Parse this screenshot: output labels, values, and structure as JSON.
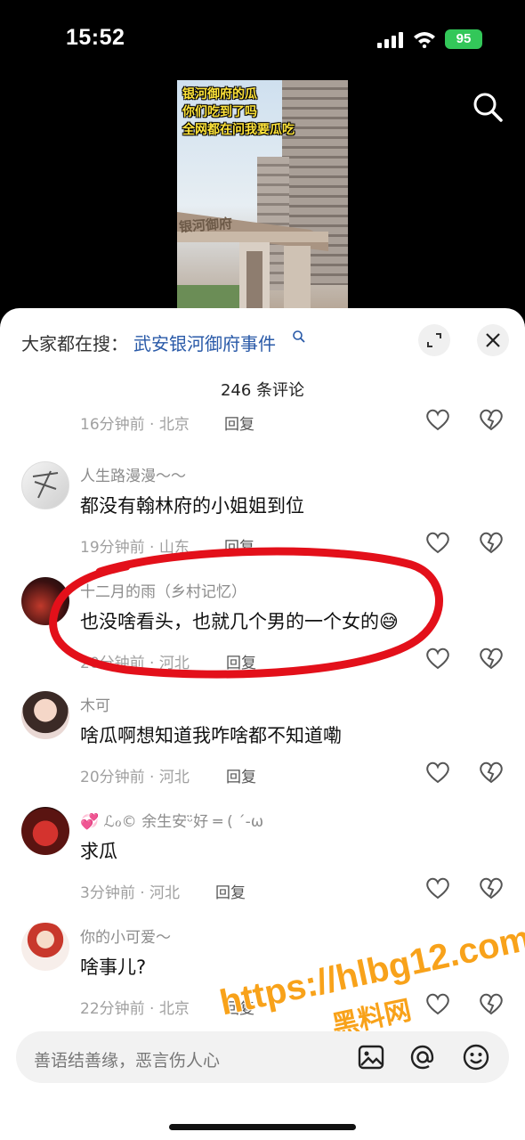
{
  "status_bar": {
    "time": "15:52",
    "battery": "95"
  },
  "video": {
    "caption_lines": [
      "银河御府的瓜",
      "你们吃到了吗",
      "全网都在问我要瓜吃"
    ],
    "gate_sign": "银河御府"
  },
  "header": {
    "hot_prefix": "大家都在搜：",
    "hot_term": "武安银河御府事件",
    "count": "246 条评论"
  },
  "comments": [
    {
      "name": "",
      "text": "",
      "time": "16分钟前",
      "location": "北京",
      "reply": "回复"
    },
    {
      "name": "人生路漫漫～～",
      "text": "都没有翰林府的小姐姐到位",
      "time": "19分钟前",
      "location": "山东",
      "reply": "回复"
    },
    {
      "name": "十二月的雨（乡村记忆）",
      "text": "也没啥看头，也就几个男的一个女的😅",
      "time": "20分钟前",
      "location": "河北",
      "reply": "回复"
    },
    {
      "name": "木可",
      "text": "啥瓜啊想知道我咋啥都不知道嘞",
      "time": "20分钟前",
      "location": "河北",
      "reply": "回复"
    },
    {
      "name": "💞 ℒℴ©  余生安ᵕ̈好 ═ ( ´-ω",
      "text": "求瓜",
      "time": "3分钟前",
      "location": "河北",
      "reply": "回复"
    },
    {
      "name": "你的小可爱～",
      "text": "啥事儿?",
      "time": "22分钟前",
      "location": "北京",
      "reply": "回复"
    }
  ],
  "meta_sep": "·",
  "watermark": {
    "url": "https://hlbg12.com",
    "name": "黑料网"
  },
  "input": {
    "placeholder": "善语结善缘，恶言伤人心"
  },
  "colors": {
    "accent": "#2a5aa8",
    "battery": "#33c759",
    "annotation": "#e3101a",
    "watermark": "#f8a21a"
  }
}
